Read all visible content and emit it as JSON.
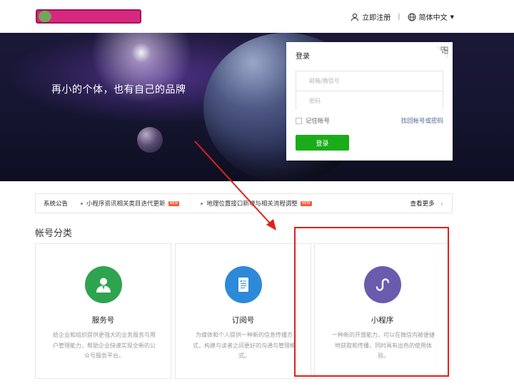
{
  "header": {
    "register_label": "立即注册",
    "language_label": "简体中文",
    "icons": [
      "user-icon",
      "globe-icon",
      "caret-down-icon"
    ]
  },
  "banner": {
    "slogan": "再小的个体，也有自己的品牌"
  },
  "login": {
    "title": "登录",
    "account_placeholder": "邮箱/微信号",
    "password_placeholder": "密码",
    "remember_label": "记住帐号",
    "forgot_label": "找回帐号或密码",
    "submit_label": "登录",
    "accent": "#1aad19"
  },
  "notice": {
    "title": "系统公告",
    "items": [
      {
        "text": "小程序资讯相关类目迭代更新",
        "badge": "NEW"
      },
      {
        "text": "地理位置接口新增与相关流程调整",
        "badge": "NEW"
      }
    ],
    "more_label": "查看更多"
  },
  "section": {
    "title": "帐号分类"
  },
  "cards": [
    {
      "name": "服务号",
      "desc": "给企业和组织提供更强大的业务服务与用户管理能力，帮助企业快速实现全新的公众号服务平台。",
      "color": "#2ea44f",
      "icon": "person-icon"
    },
    {
      "name": "订阅号",
      "desc": "为媒体和个人提供一种新的信息传播方式，构建与读者之间更好的沟通与管理模式。",
      "color": "#2d8ad8",
      "icon": "document-icon"
    },
    {
      "name": "小程序",
      "desc": "一种新的开放能力，可以在微信内被便捷地获取和传播，同时具有出色的使用体验。",
      "color": "#6b5bad",
      "icon": "mini-program-icon"
    }
  ],
  "annotations": {
    "color": "#e0201a"
  }
}
